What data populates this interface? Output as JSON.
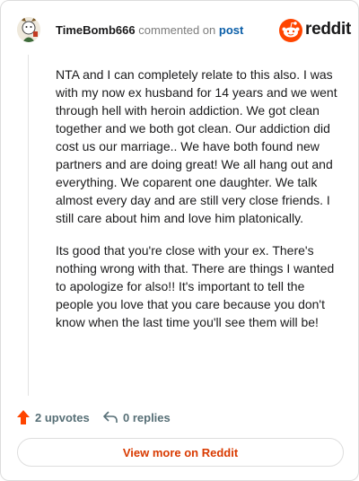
{
  "comment": {
    "username": "TimeBomb666",
    "commented_on_text": "commented on",
    "post_link": "post",
    "paragraphs": [
      "NTA and I can completely relate to this also. I was with my now ex husband for 14 years and we went through hell with heroin addiction. We got clean together and we both got clean. Our addiction did cost us our marriage.. We have both found new partners and are doing great! We all hang out and everything. We coparent one daughter. We talk almost every day and are still very close friends. I still care about him and love him platonically.",
      "Its good that you're close with your ex. There's nothing wrong with that. There are things I wanted to apologize for also!! It's important to tell the people you love that you care because you don't know when the last time you'll see them will be!"
    ],
    "upvotes_label": "2 upvotes",
    "replies_label": "0 replies"
  },
  "brand": {
    "name": "reddit",
    "logo_icon": "reddit-alien-icon",
    "color": "#ff4500"
  },
  "footer": {
    "view_more_label": "View more on Reddit"
  },
  "colors": {
    "upvote": "#ff4500",
    "link": "#0a5ea8",
    "view_more": "#d93a00"
  }
}
